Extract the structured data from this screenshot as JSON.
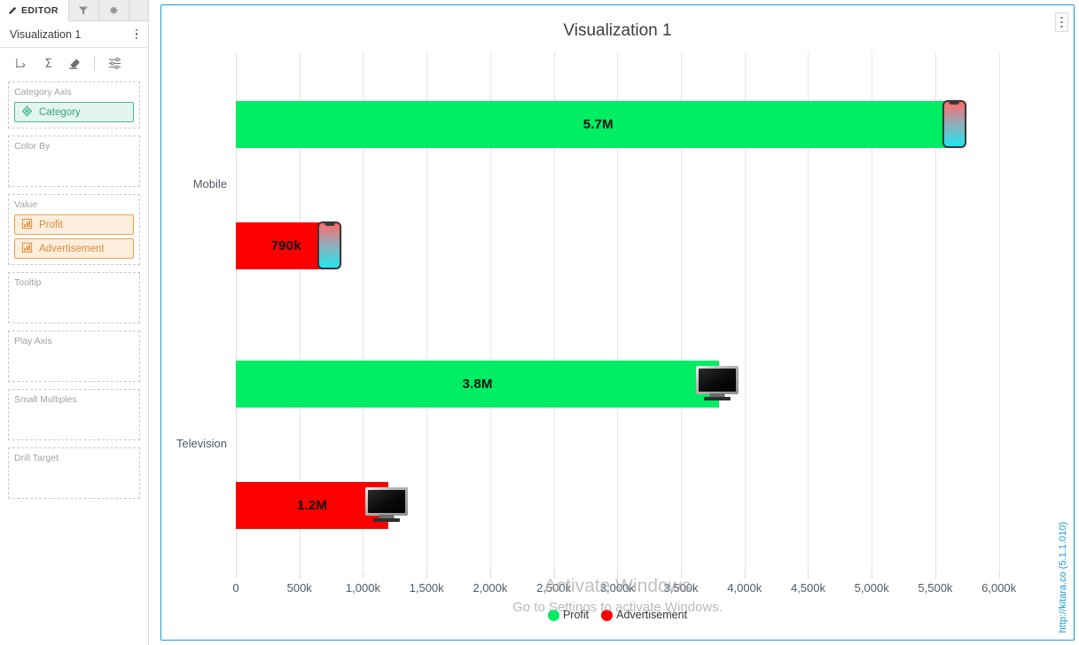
{
  "sidebar": {
    "tabs": [
      {
        "label": "EDITOR",
        "icon": "pencil-icon",
        "active": true
      },
      {
        "label": "",
        "icon": "filter-icon",
        "active": false
      },
      {
        "label": "",
        "icon": "gear-icon",
        "active": false
      }
    ],
    "viz_title": "Visualization 1",
    "toolbar": [
      {
        "name": "hierarchy-icon",
        "title": "Hierarchy"
      },
      {
        "name": "sigma-icon",
        "title": "Aggregation"
      },
      {
        "name": "eraser-icon",
        "title": "Clear"
      },
      {
        "name": "settings-sliders-icon",
        "title": "Settings"
      }
    ],
    "shelves": [
      {
        "label": "Category Axis",
        "fields": [
          {
            "label": "Category",
            "kind": "dimension"
          }
        ]
      },
      {
        "label": "Color By",
        "fields": []
      },
      {
        "label": "Value",
        "fields": [
          {
            "label": "Profit",
            "kind": "measure"
          },
          {
            "label": "Advertisement",
            "kind": "measure"
          }
        ]
      },
      {
        "label": "Tooltip",
        "fields": []
      },
      {
        "label": "Play Axis",
        "fields": []
      },
      {
        "label": "Small Multiples",
        "fields": []
      },
      {
        "label": "Drill Target",
        "fields": []
      }
    ]
  },
  "panel": {
    "title": "Visualization 1",
    "menu_icon": "kebab-menu-icon"
  },
  "watermark": {
    "line1": "Activate Windows",
    "line2": "Go to Settings to activate Windows.",
    "side_url": "http://kitara.co (5.1.1.010)"
  },
  "chart_data": {
    "type": "bar",
    "orientation": "horizontal",
    "title": "Visualization 1",
    "xlabel": "",
    "ylabel": "",
    "categories": [
      "Mobile",
      "Television"
    ],
    "series": [
      {
        "name": "Profit",
        "color": "#00ed64",
        "values": [
          5700000,
          3800000
        ],
        "labels": [
          "5.7M",
          "3.8M"
        ]
      },
      {
        "name": "Advertisement",
        "color": "#fc0000",
        "values": [
          790000,
          1200000
        ],
        "labels": [
          "790k",
          "1.2M"
        ]
      }
    ],
    "xlim": [
      0,
      6100000
    ],
    "xticks": [
      0,
      500000,
      1000000,
      1500000,
      2000000,
      2500000,
      3000000,
      3500000,
      4000000,
      4500000,
      5000000,
      5500000,
      6000000
    ],
    "xtick_labels": [
      "0",
      "500k",
      "1,000k",
      "1,500k",
      "2,000k",
      "2,500k",
      "3,000k",
      "3,500k",
      "4,000k",
      "4,500k",
      "5,000k",
      "5,500k",
      "6,000k"
    ],
    "grid": true,
    "legend_position": "bottom",
    "legend": [
      "Profit",
      "Advertisement"
    ],
    "markers": {
      "Mobile": "phone-icon",
      "Television": "tv-icon"
    }
  }
}
